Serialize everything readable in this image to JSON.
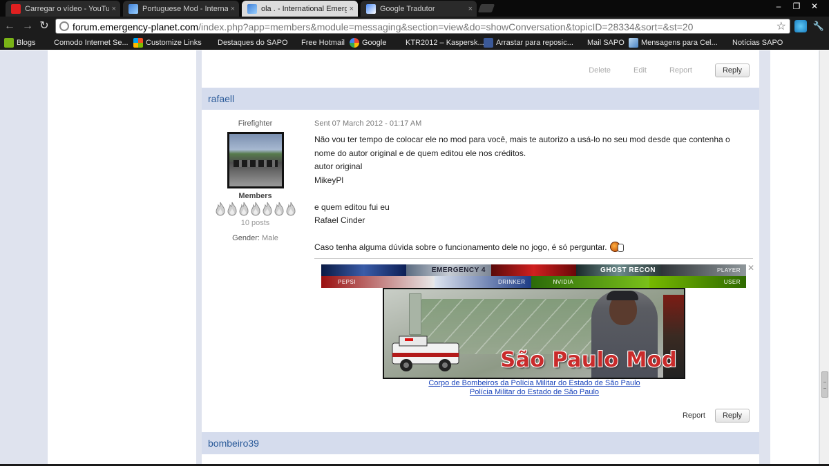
{
  "browser": {
    "tabs": [
      {
        "title": "Carregar o vídeo - YouTube",
        "favicon": "youtube-icon",
        "active": false
      },
      {
        "title": "Portuguese Mod - Internati",
        "favicon": "emergency-planet-icon",
        "active": false
      },
      {
        "title": "ola . - International Emerge",
        "favicon": "emergency-planet-icon",
        "active": true
      },
      {
        "title": "Google Tradutor",
        "favicon": "google-translate-icon",
        "active": false
      }
    ],
    "tab_close": "×",
    "window_controls": {
      "minimize": "‒",
      "restore": "❐",
      "close": "✕"
    },
    "nav": {
      "back": "←",
      "forward": "→",
      "reload": "↻"
    },
    "url_host": "forum.emergency-planet.com",
    "url_rest": "/index.php?app=members&module=messaging&section=view&do=showConversation&topicID=28334&sort=&st=20",
    "bookmark_star": "☆",
    "wrench": "🔧",
    "bookmarks": [
      {
        "label": "Blogs",
        "icon": "blogs-icon"
      },
      {
        "label": "Comodo Internet Se...",
        "icon": ""
      },
      {
        "label": "Customize Links",
        "icon": "windows-icon"
      },
      {
        "label": "Destaques do SAPO",
        "icon": ""
      },
      {
        "label": "Free Hotmail",
        "icon": ""
      },
      {
        "label": "Google",
        "icon": "google-icon"
      },
      {
        "label": "KTR2012 – Kaspersk...",
        "icon": ""
      },
      {
        "label": "Arrastar para reposic...",
        "icon": "facebook-icon"
      },
      {
        "label": "Mail SAPO",
        "icon": ""
      },
      {
        "label": "Mensagens para Cel...",
        "icon": "sms-icon"
      },
      {
        "label": "Notícias SAPO",
        "icon": ""
      }
    ]
  },
  "prev_post_actions": {
    "delete": "Delete",
    "edit": "Edit",
    "report": "Report",
    "reply": "Reply"
  },
  "post": {
    "author": "rafaell",
    "rank": "Firefighter",
    "group": "Members",
    "pips": 7,
    "posts": "10 posts",
    "gender_label": "Gender:",
    "gender_value": "Male",
    "sent": "Sent 07 March 2012 - 01:17 AM",
    "lines": [
      "Não vou ter tempo de colocar ele no mod para você, mais te autorizo a usá-lo no seu mod desde que contenha o",
      "nome do autor original e de quem editou ele nos créditos.",
      "autor original",
      "MikeyPl",
      "",
      "e quem editou fui eu",
      "Rafael Cinder",
      "",
      "Caso tenha alguma dúvida sobre o funcionamento dele no jogo, é só perguntar."
    ],
    "sig_banner": {
      "top": [
        "",
        "EMERGENCY 4",
        "",
        "GHOST RECON",
        "PLAYER"
      ],
      "bottom": [
        "PEPSI",
        "DRINKER",
        "NVIDIA",
        "USER"
      ],
      "close": "✕"
    },
    "sig_image_title": "São Paulo Mod",
    "sig_links": [
      "Corpo de Bombeiros da Polícia Militar do Estado de São Paulo",
      "Polícia Militar do Estado de São Paulo"
    ],
    "report": "Report",
    "reply": "Reply"
  },
  "next_post": {
    "author": "bombeiro39"
  }
}
